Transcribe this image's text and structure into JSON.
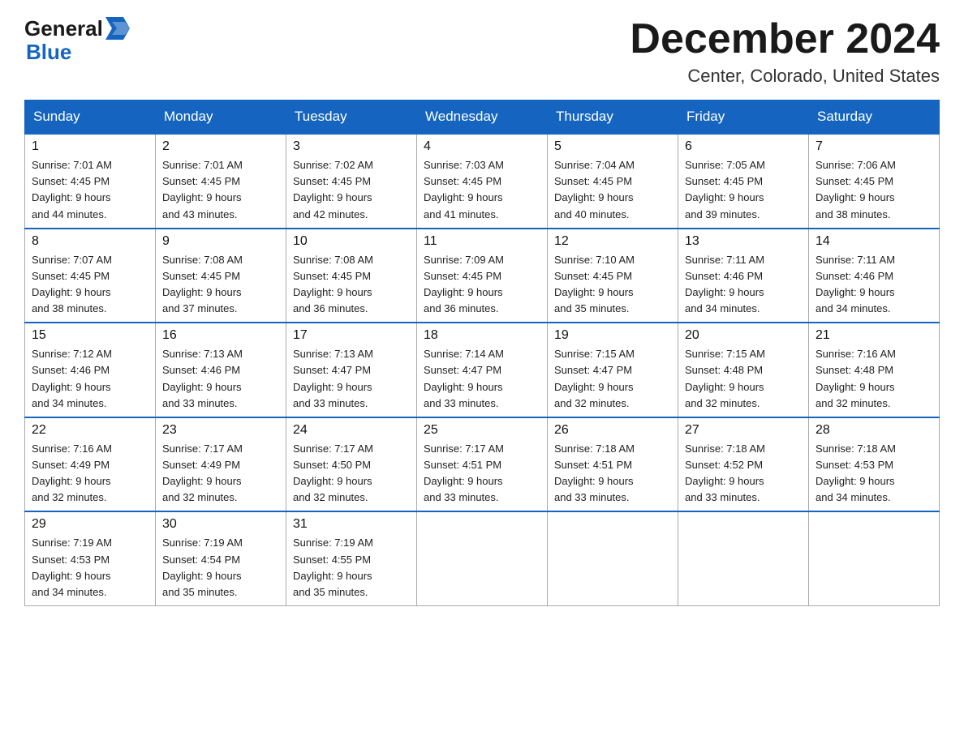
{
  "logo": {
    "line1": "General",
    "arrow": "▶",
    "line2": "Blue"
  },
  "header": {
    "month": "December 2024",
    "location": "Center, Colorado, United States"
  },
  "days_of_week": [
    "Sunday",
    "Monday",
    "Tuesday",
    "Wednesday",
    "Thursday",
    "Friday",
    "Saturday"
  ],
  "weeks": [
    [
      {
        "day": "1",
        "sunrise": "7:01 AM",
        "sunset": "4:45 PM",
        "daylight": "9 hours and 44 minutes."
      },
      {
        "day": "2",
        "sunrise": "7:01 AM",
        "sunset": "4:45 PM",
        "daylight": "9 hours and 43 minutes."
      },
      {
        "day": "3",
        "sunrise": "7:02 AM",
        "sunset": "4:45 PM",
        "daylight": "9 hours and 42 minutes."
      },
      {
        "day": "4",
        "sunrise": "7:03 AM",
        "sunset": "4:45 PM",
        "daylight": "9 hours and 41 minutes."
      },
      {
        "day": "5",
        "sunrise": "7:04 AM",
        "sunset": "4:45 PM",
        "daylight": "9 hours and 40 minutes."
      },
      {
        "day": "6",
        "sunrise": "7:05 AM",
        "sunset": "4:45 PM",
        "daylight": "9 hours and 39 minutes."
      },
      {
        "day": "7",
        "sunrise": "7:06 AM",
        "sunset": "4:45 PM",
        "daylight": "9 hours and 38 minutes."
      }
    ],
    [
      {
        "day": "8",
        "sunrise": "7:07 AM",
        "sunset": "4:45 PM",
        "daylight": "9 hours and 38 minutes."
      },
      {
        "day": "9",
        "sunrise": "7:08 AM",
        "sunset": "4:45 PM",
        "daylight": "9 hours and 37 minutes."
      },
      {
        "day": "10",
        "sunrise": "7:08 AM",
        "sunset": "4:45 PM",
        "daylight": "9 hours and 36 minutes."
      },
      {
        "day": "11",
        "sunrise": "7:09 AM",
        "sunset": "4:45 PM",
        "daylight": "9 hours and 36 minutes."
      },
      {
        "day": "12",
        "sunrise": "7:10 AM",
        "sunset": "4:45 PM",
        "daylight": "9 hours and 35 minutes."
      },
      {
        "day": "13",
        "sunrise": "7:11 AM",
        "sunset": "4:46 PM",
        "daylight": "9 hours and 34 minutes."
      },
      {
        "day": "14",
        "sunrise": "7:11 AM",
        "sunset": "4:46 PM",
        "daylight": "9 hours and 34 minutes."
      }
    ],
    [
      {
        "day": "15",
        "sunrise": "7:12 AM",
        "sunset": "4:46 PM",
        "daylight": "9 hours and 34 minutes."
      },
      {
        "day": "16",
        "sunrise": "7:13 AM",
        "sunset": "4:46 PM",
        "daylight": "9 hours and 33 minutes."
      },
      {
        "day": "17",
        "sunrise": "7:13 AM",
        "sunset": "4:47 PM",
        "daylight": "9 hours and 33 minutes."
      },
      {
        "day": "18",
        "sunrise": "7:14 AM",
        "sunset": "4:47 PM",
        "daylight": "9 hours and 33 minutes."
      },
      {
        "day": "19",
        "sunrise": "7:15 AM",
        "sunset": "4:47 PM",
        "daylight": "9 hours and 32 minutes."
      },
      {
        "day": "20",
        "sunrise": "7:15 AM",
        "sunset": "4:48 PM",
        "daylight": "9 hours and 32 minutes."
      },
      {
        "day": "21",
        "sunrise": "7:16 AM",
        "sunset": "4:48 PM",
        "daylight": "9 hours and 32 minutes."
      }
    ],
    [
      {
        "day": "22",
        "sunrise": "7:16 AM",
        "sunset": "4:49 PM",
        "daylight": "9 hours and 32 minutes."
      },
      {
        "day": "23",
        "sunrise": "7:17 AM",
        "sunset": "4:49 PM",
        "daylight": "9 hours and 32 minutes."
      },
      {
        "day": "24",
        "sunrise": "7:17 AM",
        "sunset": "4:50 PM",
        "daylight": "9 hours and 32 minutes."
      },
      {
        "day": "25",
        "sunrise": "7:17 AM",
        "sunset": "4:51 PM",
        "daylight": "9 hours and 33 minutes."
      },
      {
        "day": "26",
        "sunrise": "7:18 AM",
        "sunset": "4:51 PM",
        "daylight": "9 hours and 33 minutes."
      },
      {
        "day": "27",
        "sunrise": "7:18 AM",
        "sunset": "4:52 PM",
        "daylight": "9 hours and 33 minutes."
      },
      {
        "day": "28",
        "sunrise": "7:18 AM",
        "sunset": "4:53 PM",
        "daylight": "9 hours and 34 minutes."
      }
    ],
    [
      {
        "day": "29",
        "sunrise": "7:19 AM",
        "sunset": "4:53 PM",
        "daylight": "9 hours and 34 minutes."
      },
      {
        "day": "30",
        "sunrise": "7:19 AM",
        "sunset": "4:54 PM",
        "daylight": "9 hours and 35 minutes."
      },
      {
        "day": "31",
        "sunrise": "7:19 AM",
        "sunset": "4:55 PM",
        "daylight": "9 hours and 35 minutes."
      },
      null,
      null,
      null,
      null
    ]
  ],
  "labels": {
    "sunrise": "Sunrise:",
    "sunset": "Sunset:",
    "daylight": "Daylight:"
  }
}
